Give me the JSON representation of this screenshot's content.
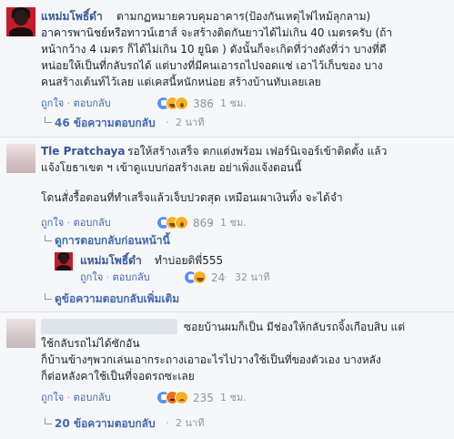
{
  "comment1": {
    "author": "แหม่มโพธิ์ดำ",
    "lines": [
      "ตามกฏหมายควบคุมอาคาร(ป้องกันเหตุไฟไหม้ลุกลาม)",
      "อาคารพานิชย์หรือทาวน์เฮาส์ จะสร้างติดกันยาวได้ไม่เกิน 40 เมตรครับ (ถ้า",
      "หน้ากว้าง 4 เมตร ก็ได้ไม่เกิน 10 ยูนิต ) ดังนั้นก็จะเกิดที่ว่างดังที่ว่า บางที่ดี",
      "หน่อยให้เป็นที่กลับรถได้ แต่บางที่มีคนเอารถไปจอดแช่ เอาไว้เก็บของ บาง",
      "คนสร้างเต้นท์ไว้เลย แต่เคสนี้หนักหน่อย สร้างบ้านทับเลยเลย"
    ],
    "like_label": "ถูกใจ",
    "reply_label": "ตอบกลับ",
    "reaction_icons": [
      "like-icon",
      "haha-icon",
      "wow-icon"
    ],
    "reaction_count": "386",
    "time": "1 ชม.",
    "replies_link": "46 ข้อความตอบกลับ",
    "replies_time": "2 นาที"
  },
  "comment2": {
    "author": "Tle Pratchaya",
    "first_line_text": "รอให้สร้างเสร็จ ตกแต่งพร้อม เฟอร์นิเจอร์เข้าติดตั้ง แล้ว",
    "lines": [
      "แจ้งโยธาเขต ฯ เข้าดูแบบก่อสร้างเลย อย่าเพิ่งแจ้งตอนนี้",
      "โดนสั่งรื้อตอนที่ทำเสร็จแล้วเจ็บปวดสุด เหมือนเผาเงินทิ้ง จะได้จำ"
    ],
    "like_label": "ถูกใจ",
    "reply_label": "ตอบกลับ",
    "reaction_icons": [
      "like-icon",
      "haha-icon",
      "wow-icon"
    ],
    "reaction_count": "869",
    "time": "1 ชม.",
    "previous_link": "ดูการตอบกลับก่อนหน้านี้"
  },
  "reply1": {
    "author": "แหม่มโพธิ์ดำ",
    "text": "ทำบ่อยดิพี่555",
    "like_label": "ถูกใจ",
    "reply_label": "ตอบกลับ",
    "reaction_icons": [
      "like-icon",
      "haha-icon"
    ],
    "reaction_count": "24",
    "time": "32 นาที",
    "more_link": "ดูข้อความตอบกลับเพิ่มเติม"
  },
  "comment3": {
    "lines": [
      "ซอยบ้านผมก็เป็น มีช่องให้กลับรถจิ้งเกือบสิบ แต่",
      "ใช้กลับรถไม่ได้ซักอัน",
      "ก็บ้านข้างๆพวกเล่นเอากระถางเอาอะไรไปวางใช้เป็นที่ของตัวเอง บางหลัง",
      "ก็ต่อหลังคาใช้เป็นที่จอดรถซะเลย"
    ],
    "like_label": "ถูกใจ",
    "reply_label": "ตอบกลับ",
    "reaction_icons": [
      "like-icon",
      "angry-icon",
      "sad-icon"
    ],
    "reaction_count": "235",
    "time": "1 ชม.",
    "replies_link": "20 ข้อความตอบกลับ",
    "replies_time": "2 นาที"
  },
  "colors": {
    "background": "#f6f7f9",
    "link": "#4267b2",
    "author": "#365899",
    "meta": "#90949c",
    "text": "#1d2129"
  }
}
